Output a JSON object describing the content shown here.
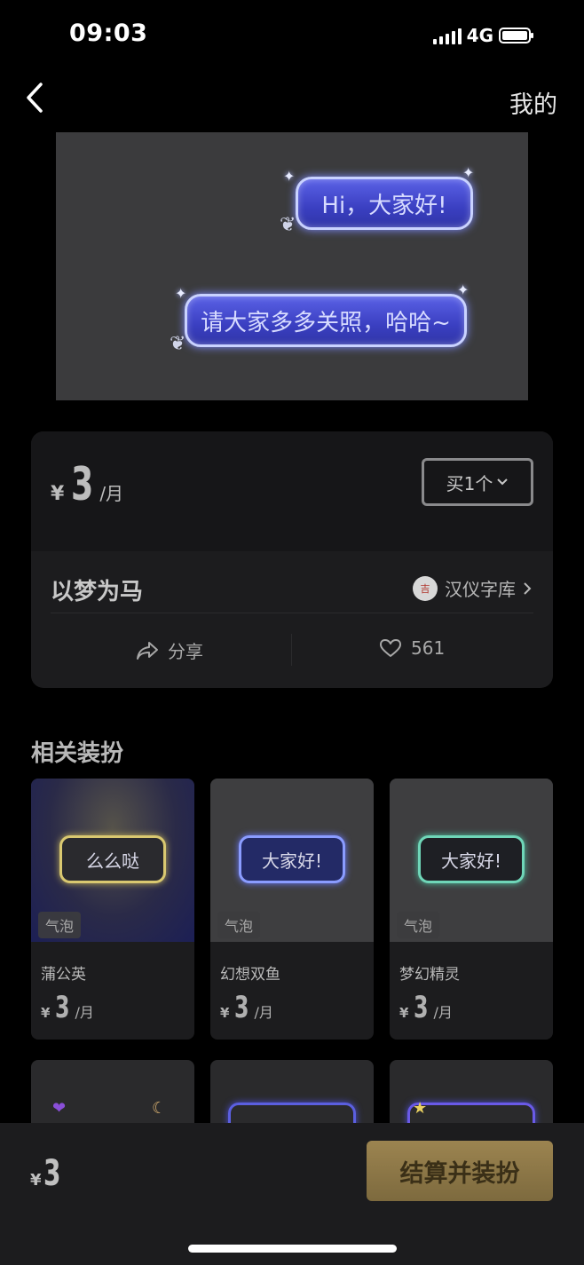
{
  "status_bar": {
    "time": "09:03",
    "network": "4G"
  },
  "nav": {
    "right_label": "我的"
  },
  "preview": {
    "bubble1_text": "Hi，大家好!",
    "bubble2_text": "请大家多多关照，哈哈~"
  },
  "product": {
    "currency": "¥",
    "price": "3",
    "unit": "/月",
    "quantity_label": "买1个",
    "name": "以梦为马",
    "brand": "汉仪字库",
    "share_label": "分享",
    "likes": "561"
  },
  "related": {
    "title": "相关装扮",
    "items": [
      {
        "image_text": "么么哒",
        "tag": "气泡",
        "name": "蒲公英",
        "currency": "¥",
        "price": "3",
        "unit": "/月"
      },
      {
        "image_text": "大家好!",
        "tag": "气泡",
        "name": "幻想双鱼",
        "currency": "¥",
        "price": "3",
        "unit": "/月"
      },
      {
        "image_text": "大家好!",
        "tag": "气泡",
        "name": "梦幻精灵",
        "currency": "¥",
        "price": "3",
        "unit": "/月"
      }
    ]
  },
  "bottom_bar": {
    "currency": "¥",
    "total": "3",
    "checkout_label": "结算并装扮"
  },
  "colors": {
    "background": "#000000",
    "card": "#1c1c1e",
    "checkout_gold": "#9c8450",
    "bubble_blue": "#3a3fc1"
  },
  "icons": [
    "back-icon",
    "signal-icon",
    "battery-icon",
    "chevron-down-icon",
    "chevron-right-icon",
    "share-icon",
    "heart-icon"
  ]
}
